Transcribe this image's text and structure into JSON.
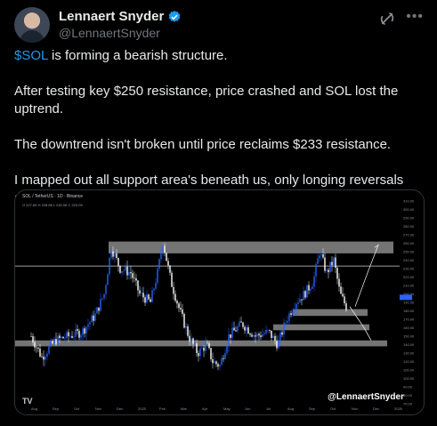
{
  "author": {
    "name": "Lennaert Snyder",
    "handle": "@LennaertSnyder"
  },
  "icons": {
    "verified": "verified-badge-icon",
    "grok": "grok-icon",
    "more": "more-icon"
  },
  "post": {
    "cashtag": "$SOL",
    "line1_rest": " is forming a bearish structure.",
    "line2": "After testing key $250 resistance, price crashed and SOL lost the uptrend.",
    "line3": "The downtrend isn't broken until price reclaims $233 resistance.",
    "line4": "I mapped out all support area's beneath us, only longing reversals and shorting the continuation."
  },
  "chart": {
    "title": "SOL / TetherUS · 1D · Binance",
    "ohlc": "O 227.65 H 228.86 L 220.08 C 223.05",
    "watermark": "@LennaertSnyder",
    "logo": "TV",
    "price_labels": [
      "310.00",
      "300.00",
      "290.00",
      "280.00",
      "270.00",
      "260.00",
      "250.00",
      "240.00",
      "230.00",
      "220.00",
      "210.00",
      "200.00",
      "190.00",
      "180.00",
      "170.00",
      "160.00",
      "150.00",
      "140.00",
      "130.00",
      "120.00",
      "110.00",
      "100.00",
      "90.00",
      "80.00",
      "70.00"
    ],
    "time_labels": [
      "Aug",
      "Sep",
      "Oct",
      "Nov",
      "Dec",
      "2025",
      "Feb",
      "Mar",
      "Apr",
      "May",
      "Jun",
      "Jul",
      "Aug",
      "Sep",
      "Oct",
      "Nov",
      "Dec",
      "2026"
    ],
    "colors": {
      "up": "#26a69a",
      "down": "#ef5350",
      "zone": "#7a7a7a",
      "candle_up": "#2962ff",
      "candle_down": "#ffffff"
    }
  }
}
